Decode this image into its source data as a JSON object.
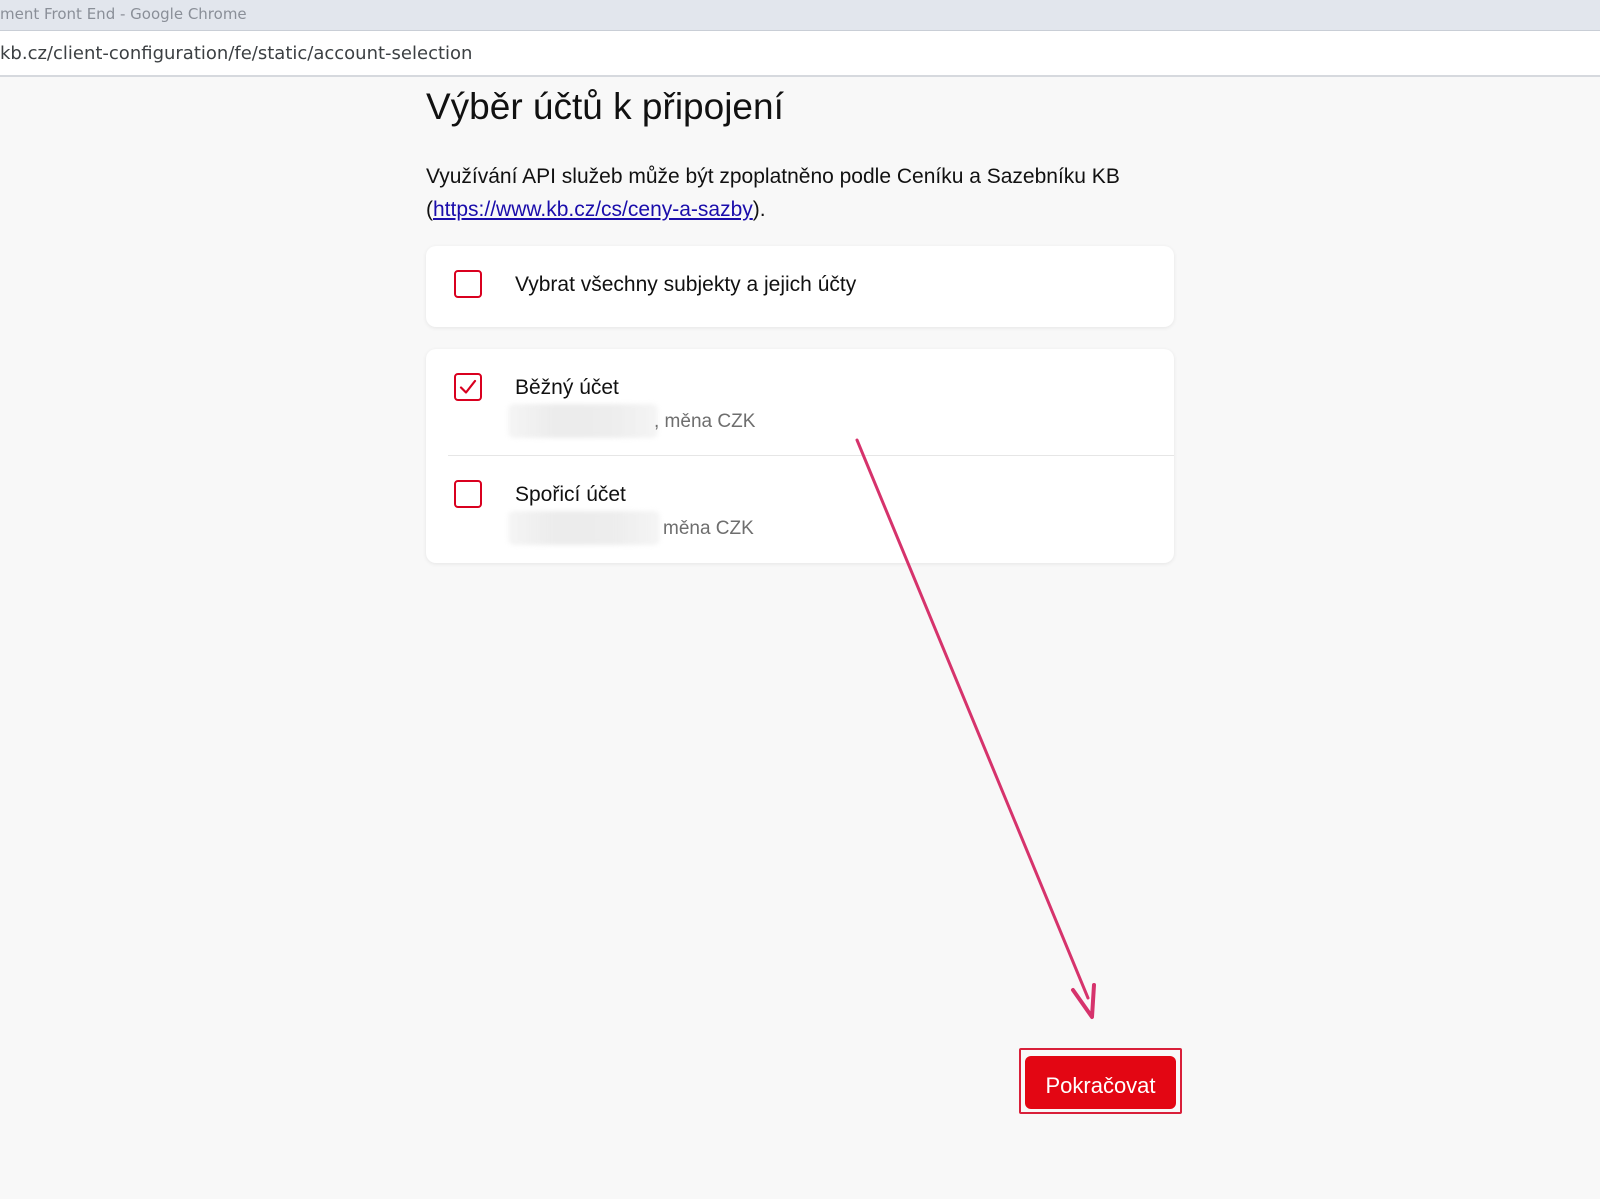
{
  "window": {
    "title": "ment Front End - Google Chrome"
  },
  "browser": {
    "url": "kb.cz/client-configuration/fe/static/account-selection"
  },
  "page": {
    "title": "Výběr účtů k připojení",
    "intro_text": "Využívání API služeb může být zpoplatněno podle Ceníku a Sazebníku KB",
    "intro_open": "(",
    "intro_link": "https://www.kb.cz/cs/ceny-a-sazby",
    "intro_close": ")."
  },
  "select_all": {
    "label": "Vybrat všechny subjekty a jejich účty",
    "checked": false
  },
  "accounts": [
    {
      "name": "Běžný účet",
      "detail": ", měna CZK",
      "checked": true
    },
    {
      "name": "Spořicí účet",
      "detail": "měna CZK",
      "checked": false
    }
  ],
  "actions": {
    "continue_label": "Pokračovat"
  },
  "colors": {
    "brand_red": "#e30613",
    "checkbox_border": "#d9001f",
    "annotation_arrow": "#d6336c",
    "link": "#1a0dab"
  },
  "icons": {
    "checkmark": "checkmark-icon",
    "arrow": "annotation-arrow"
  }
}
